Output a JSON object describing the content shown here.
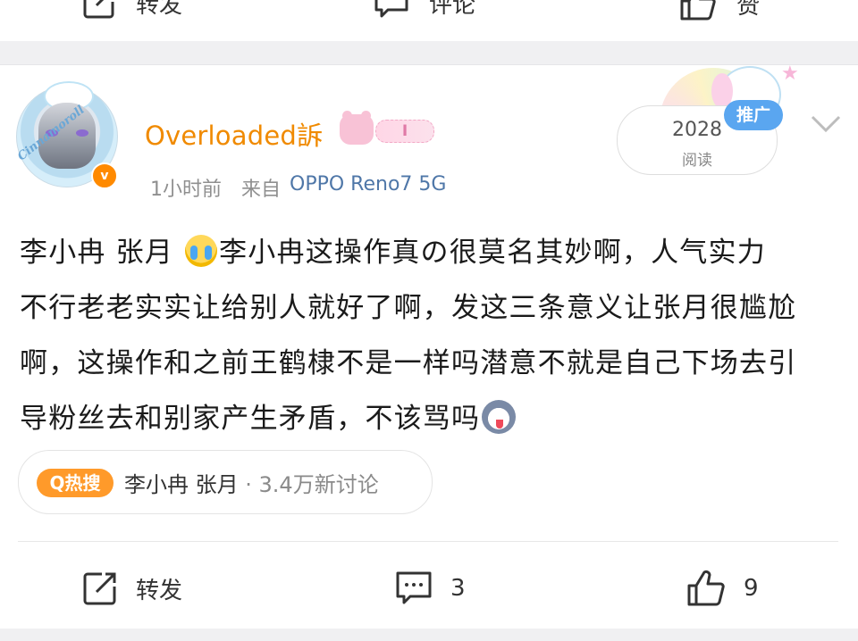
{
  "prev_actions": {
    "repost_label": "转发",
    "comment_label": "评论",
    "like_label": "赞"
  },
  "post": {
    "author": {
      "name": "Overloaded訴",
      "badge_level": "I",
      "avatar_text": "Cinnamoroll"
    },
    "time": "1小时前",
    "source_prefix": "来自",
    "device": "OPPO Reno7 5G",
    "read_count": "2028",
    "read_label": "阅读",
    "promo_label": "推广",
    "body_lines": [
      {
        "before_emoji": "李小冉 张月 ",
        "after_emoji": "李小冉这操作真の很莫名其妙啊，人气实力"
      },
      {
        "text": "不行老老实实让给别人就好了啊，发这三条意义让张月很尴尬"
      },
      {
        "text": "啊，这操作和之前王鹤棣不是一样吗潜意不就是自己下场去引"
      },
      {
        "before_emoji": "导粉丝去和别家产生矛盾，不该骂吗"
      }
    ],
    "hot_search": {
      "tag": "Q热搜",
      "topic": "李小冉 张月",
      "separator": " · ",
      "count": "3.4万新讨论"
    },
    "actions": {
      "repost_label": "转发",
      "comment_count": "3",
      "like_count": "9"
    }
  },
  "colors": {
    "username": "#f08a00",
    "device_link": "#4f77a8",
    "hot_tag": "#ff9a2a",
    "promo_tag": "#5aa6f0"
  },
  "icons": [
    "repost-icon",
    "comment-icon",
    "like-icon",
    "verified-badge-icon",
    "chevron-down-icon",
    "crying-face-emoji",
    "dog-emoji"
  ]
}
